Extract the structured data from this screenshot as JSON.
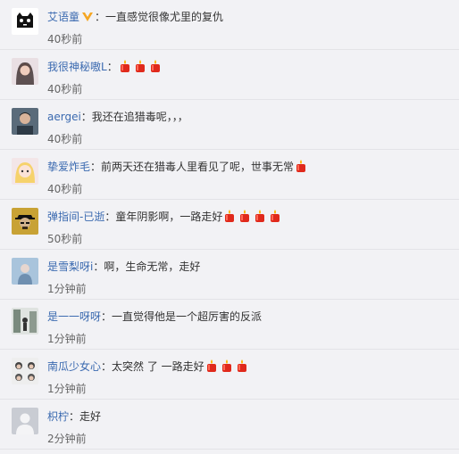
{
  "comments": [
    {
      "user": "艾语童",
      "verified": true,
      "text": "：一直感觉很像尤里的复仇",
      "candles": 0,
      "time": "40秒前",
      "avatar_icon": "tmall-cat-avatar"
    },
    {
      "user": "我很神秘嗷L",
      "verified": false,
      "text": "：",
      "candles": 3,
      "time": "40秒前",
      "avatar_icon": "girl-photo-avatar"
    },
    {
      "user": "aergei",
      "verified": false,
      "text": "：我还在追猎毒呢，，，",
      "candles": 0,
      "time": "40秒前",
      "avatar_icon": "man-photo-avatar"
    },
    {
      "user": "挚爱炸毛",
      "verified": false,
      "text": "：前两天还在猎毒人里看见了呢，世事无常",
      "candles": 1,
      "time": "40秒前",
      "avatar_icon": "anime-girl-avatar"
    },
    {
      "user": "弹指间-已逝",
      "verified": false,
      "text": "：童年阴影啊，一路走好",
      "candles": 4,
      "time": "50秒前",
      "avatar_icon": "heisenberg-avatar"
    },
    {
      "user": "是雪梨呀i",
      "verified": false,
      "text": "：啊，生命无常，走好",
      "candles": 0,
      "time": "1分钟前",
      "avatar_icon": "blue-photo-avatar"
    },
    {
      "user": "是一一呀呀",
      "verified": false,
      "text": "：一直觉得他是一个超厉害的反派",
      "candles": 0,
      "time": "1分钟前",
      "avatar_icon": "street-photo-avatar"
    },
    {
      "user": "南瓜少女心",
      "verified": false,
      "text": "：太突然 了 一路走好",
      "candles": 3,
      "time": "1分钟前",
      "avatar_icon": "group-photo-avatar"
    },
    {
      "user": "枳柠",
      "verified": false,
      "text": "：走好",
      "candles": 0,
      "time": "2分钟前",
      "avatar_icon": "default-avatar"
    }
  ],
  "colors": {
    "name": "#3b6ab0",
    "text": "#333333",
    "time": "#666666",
    "background": "#f2f2f5",
    "candle": "#e0291b"
  }
}
